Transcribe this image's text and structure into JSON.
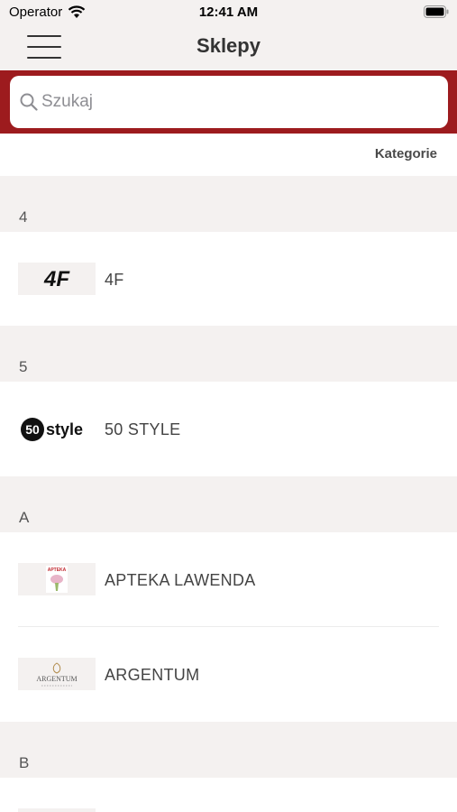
{
  "status_bar": {
    "carrier": "Operator",
    "time": "12:41 AM"
  },
  "nav": {
    "title": "Sklepy"
  },
  "search": {
    "placeholder": "Szukaj"
  },
  "categories_link": "Kategorie",
  "sections": [
    {
      "letter": "4",
      "items": [
        {
          "name": "4F",
          "logo_text": "4F"
        }
      ]
    },
    {
      "letter": "5",
      "items": [
        {
          "name": "50 STYLE",
          "logo_text": "50 style"
        }
      ]
    },
    {
      "letter": "A",
      "items": [
        {
          "name": "APTEKA LAWENDA",
          "logo_text": "APTEKA"
        },
        {
          "name": "ARGENTUM",
          "logo_text": "ARGENTUM"
        }
      ]
    },
    {
      "letter": "B",
      "items": []
    }
  ],
  "colors": {
    "accent": "#9d1b1e",
    "background": "#f4f1f0"
  },
  "icons": {
    "menu": "hamburger-icon",
    "search": "search-icon",
    "wifi": "wifi-icon",
    "battery": "battery-icon"
  }
}
